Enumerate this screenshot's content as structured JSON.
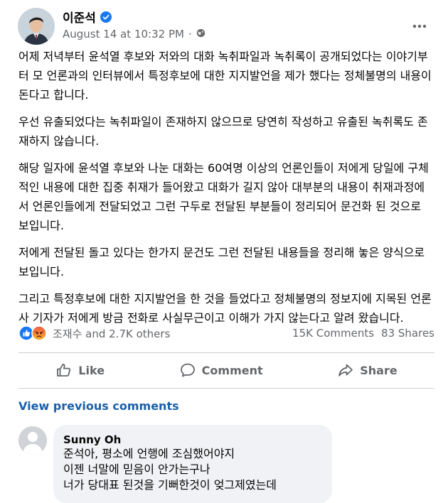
{
  "post": {
    "author": "이준석",
    "timestamp": "August 14 at 10:32 PM",
    "separator": "·",
    "verified_icon": "verified-badge-icon",
    "audience_icon": "globe-icon",
    "menu_icon": "more-horizontal-icon",
    "paragraphs": [
      "어제 저녁부터 윤석열 후보와 저와의 대화 녹취파일과 녹취록이 공개되었다는 이야기부터 모 언론과의 인터뷰에서 특정후보에 대한 지지발언을 제가 했다는 정체불명의 내용이 돈다고 합니다.",
      "우선 유출되었다는 녹취파일이 존재하지 않으므로 당연히 작성하고 유출된 녹취록도 존재하지 않습니다.",
      "해당 일자에 윤석열 후보와 나눈 대화는 60여명 이상의 언론인들이 저에게 당일에 구체적인 내용에 대한 집중 취재가 들어왔고 대화가 길지 않아 대부분의 내용이 취재과정에서 언론인들에게 전달되었고 그런 구두로 전달된 부분들이 정리되어 문건화 된 것으로 보입니다.",
      "저에게 전달된 돌고 있다는 한가지 문건도 그런 전달된 내용들을 정리해 놓은 양식으로 보입니다.",
      "그리고 특정후보에 대한 지지발언을 한 것을 들었다고 정체불명의 정보지에 지목된 언론사 기자가 저에게 방금 전화로 사실무근이고 이해가 가지 않는다고 알려 왔습니다."
    ]
  },
  "reactions": {
    "summary": "조재수 and 2.7K others",
    "icons": [
      "like-reaction-icon",
      "angry-reaction-icon"
    ],
    "comments_count": "15K Comments",
    "shares_count": "83 Shares"
  },
  "actions": {
    "like_label": "Like",
    "comment_label": "Comment",
    "share_label": "Share"
  },
  "comments": {
    "view_previous_label": "View previous comments",
    "items": [
      {
        "name": "Sunny Oh",
        "lines": [
          "준석아, 평소에 언행에 조심했어야지",
          "이젠 너말에 믿음이 안가는구나",
          "너가 당대표 된것을 기뻐한것이 엊그제였는데"
        ]
      }
    ]
  },
  "colors": {
    "accent": "#1877f2",
    "secondary_text": "#65676b",
    "link": "#1a5fa8",
    "bubble": "#f0f2f5"
  }
}
